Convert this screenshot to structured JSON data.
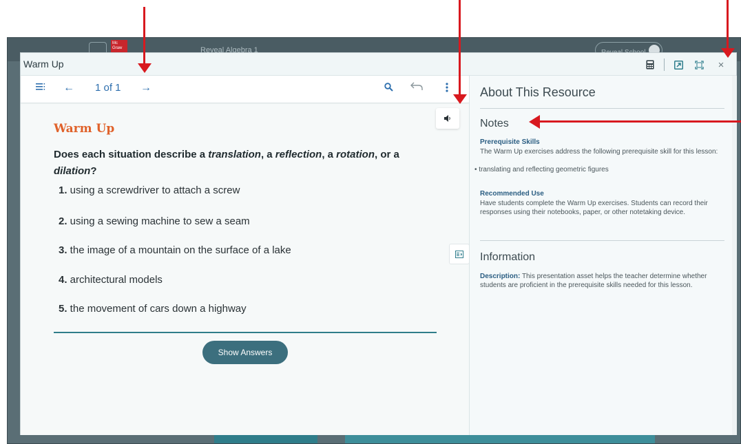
{
  "background_app": {
    "title": "Reveal Algebra 1",
    "logo_text": "Mc Graw",
    "school_label": "Reveal School"
  },
  "modal": {
    "title": "Warm Up",
    "header_icons": [
      "calculator-icon",
      "external-link-icon",
      "expand-icon",
      "close-icon"
    ],
    "close_glyph": "×"
  },
  "toolbar": {
    "page_indicator": "1 of 1"
  },
  "content": {
    "heading": "Warm Up",
    "question_parts": {
      "pre": "Does each situation describe a ",
      "t1": "translation",
      "s1": ", a ",
      "t2": "reflection",
      "s2": ", a ",
      "t3": "rotation",
      "s3": ", or a ",
      "t4": "dilation",
      "post": "?"
    },
    "items": [
      {
        "num": "1.",
        "text": " using a screwdriver to attach a screw"
      },
      {
        "num": "2.",
        "text": " using a sewing machine to sew a seam"
      },
      {
        "num": "3.",
        "text": " the image of a mountain on the surface of a lake"
      },
      {
        "num": "4.",
        "text": " architectural models"
      },
      {
        "num": "5.",
        "text": " the movement of cars down a highway"
      }
    ],
    "show_answers_label": "Show Answers"
  },
  "right_panel": {
    "title": "About This Resource",
    "notes_heading": "Notes",
    "prereq_heading": "Prerequisite Skills",
    "prereq_text": "The Warm Up exercises address the following prerequisite skill for this lesson:",
    "prereq_bullet": "translating and reflecting geometric figures",
    "recommended_heading": "Recommended Use",
    "recommended_text": "Have students complete the Warm Up exercises. Students can record their responses using their notebooks, paper, or other notetaking device.",
    "info_heading": "Information",
    "description_label": "Description:",
    "description_text": " This presentation asset helps the teacher determine whether students are proficient in the prerequisite skills needed for this lesson."
  },
  "colors": {
    "accent_orange": "#e0622b",
    "accent_teal": "#2f7d8a",
    "annotation_red": "#d8191f",
    "link_blue": "#2e6fae"
  }
}
